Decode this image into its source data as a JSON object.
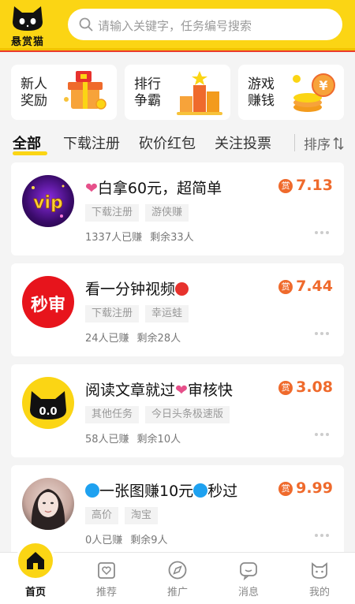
{
  "header": {
    "logo_text": "悬赏猫",
    "search_placeholder": "请输入关键字，任务编号搜索"
  },
  "tiles": [
    {
      "label": "新人奖励"
    },
    {
      "label": "排行争霸"
    },
    {
      "label": "游戏赚钱"
    }
  ],
  "tabs": {
    "items": [
      {
        "label": "全部",
        "active": true
      },
      {
        "label": "下载注册"
      },
      {
        "label": "砍价红包"
      },
      {
        "label": "关注投票"
      }
    ],
    "sort_label": "排序"
  },
  "tasks": [
    {
      "avatar": "vip-avatar",
      "avatar_text": "vip",
      "title": "白拿60元，超简单",
      "reward_badge": "赏",
      "reward": "7.13",
      "tags": [
        "下载注册",
        "游侠赚"
      ],
      "earned": "1337人已赚",
      "remaining": "剩余33人"
    },
    {
      "avatar": "miaoshen-avatar",
      "avatar_text": "秒审",
      "title": "看一分钟视频",
      "reward_badge": "赏",
      "reward": "7.44",
      "tags": [
        "下载注册",
        "幸运蛙"
      ],
      "earned": "24人已赚",
      "remaining": "剩余28人"
    },
    {
      "avatar": "cat-avatar",
      "avatar_text": "0.0",
      "title_a": "阅读文章就过",
      "title_b": "审核快",
      "reward_badge": "赏",
      "reward": "3.08",
      "tags": [
        "其他任务",
        "今日头条极速版"
      ],
      "earned": "58人已赚",
      "remaining": "剩余10人"
    },
    {
      "avatar": "girl-avatar",
      "title_a": "一张图赚10元",
      "title_b": "秒过",
      "reward_badge": "赏",
      "reward": "9.99",
      "tags": [
        "高价",
        "淘宝"
      ],
      "earned": "0人已赚",
      "remaining": "剩余9人"
    }
  ],
  "bottom_nav": [
    {
      "label": "首页",
      "icon": "home-icon",
      "active": true
    },
    {
      "label": "推荐",
      "icon": "heart-box-icon"
    },
    {
      "label": "推广",
      "icon": "compass-icon"
    },
    {
      "label": "消息",
      "icon": "message-icon"
    },
    {
      "label": "我的",
      "icon": "cat-face-icon"
    }
  ],
  "colors": {
    "brand_yellow": "#fbd514",
    "reward_orange": "#ef6a2c",
    "accent_red": "#ea3b2e"
  }
}
